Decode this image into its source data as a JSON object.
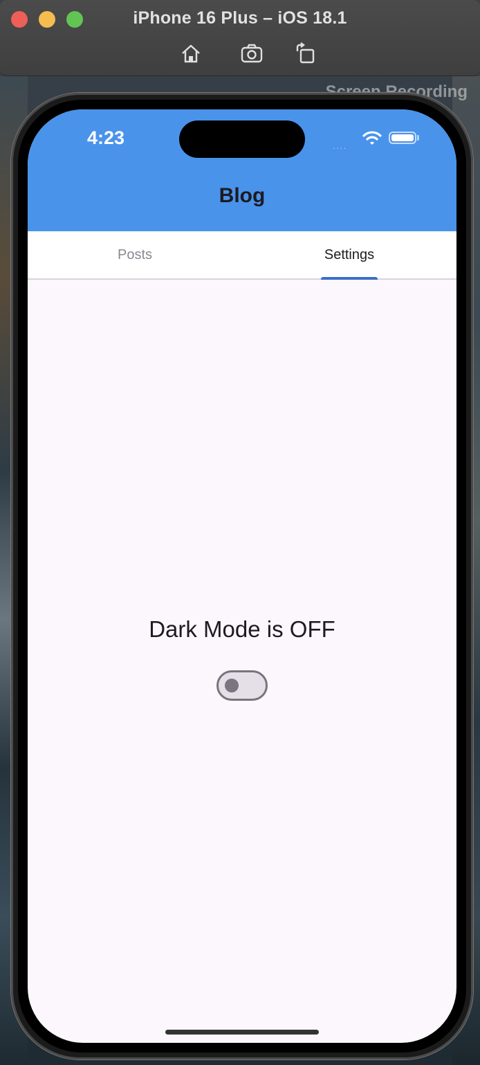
{
  "simulator": {
    "title": "iPhone 16 Plus – iOS 18.1",
    "recording_overlay": "Screen Recording",
    "tools": [
      "home-icon",
      "screenshot-icon",
      "rotate-icon"
    ]
  },
  "status_bar": {
    "time": "4:23",
    "signal": "....",
    "icons": [
      "wifi-icon",
      "battery-icon"
    ]
  },
  "app": {
    "title": "Blog",
    "header_color": "#4a93eb",
    "background_color": "#fbf7fc"
  },
  "tabs": [
    {
      "label": "Posts",
      "selected": false
    },
    {
      "label": "Settings",
      "selected": true
    }
  ],
  "settings": {
    "dark_mode_label": "Dark Mode is OFF",
    "dark_mode_enabled": false
  }
}
